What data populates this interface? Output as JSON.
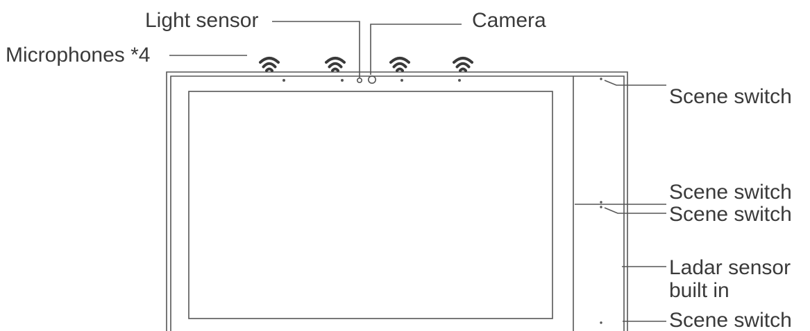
{
  "labels": {
    "light_sensor": "Light sensor",
    "camera": "Camera",
    "microphones": "Microphones *4",
    "scene_switch_top": "Scene switch",
    "scene_switch_mid_1": "Scene switch",
    "scene_switch_mid_2": "Scene switch",
    "ladar_sensor_line1": "Ladar sensor",
    "ladar_sensor_line2": "built in",
    "scene_switch_bottom": "Scene switch"
  },
  "colors": {
    "line": "#555555",
    "text": "#3a3a3a",
    "background": "#ffffff"
  }
}
